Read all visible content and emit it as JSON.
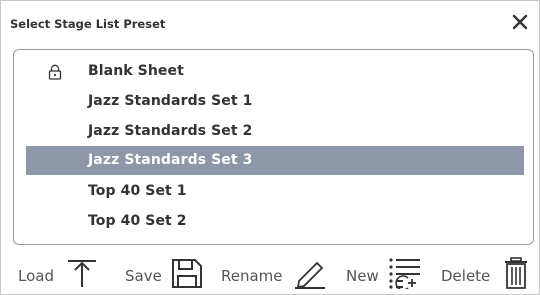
{
  "dialog": {
    "title": "Select Stage List Preset",
    "close_icon": "close-icon"
  },
  "presets": [
    {
      "label": "Blank Sheet",
      "locked": true,
      "selected": false
    },
    {
      "label": "Jazz Standards Set 1",
      "locked": false,
      "selected": false
    },
    {
      "label": "Jazz Standards Set 2",
      "locked": false,
      "selected": false
    },
    {
      "label": "Jazz Standards Set 3",
      "locked": false,
      "selected": true
    },
    {
      "label": "Top 40 Set 1",
      "locked": false,
      "selected": false
    },
    {
      "label": "Top 40 Set 2",
      "locked": false,
      "selected": false
    }
  ],
  "toolbar": {
    "load_label": "Load",
    "save_label": "Save",
    "rename_label": "Rename",
    "new_label": "New",
    "delete_label": "Delete"
  },
  "colors": {
    "selected_row": "#8d97a7",
    "text": "#333333",
    "toolbar_text": "#555555"
  }
}
